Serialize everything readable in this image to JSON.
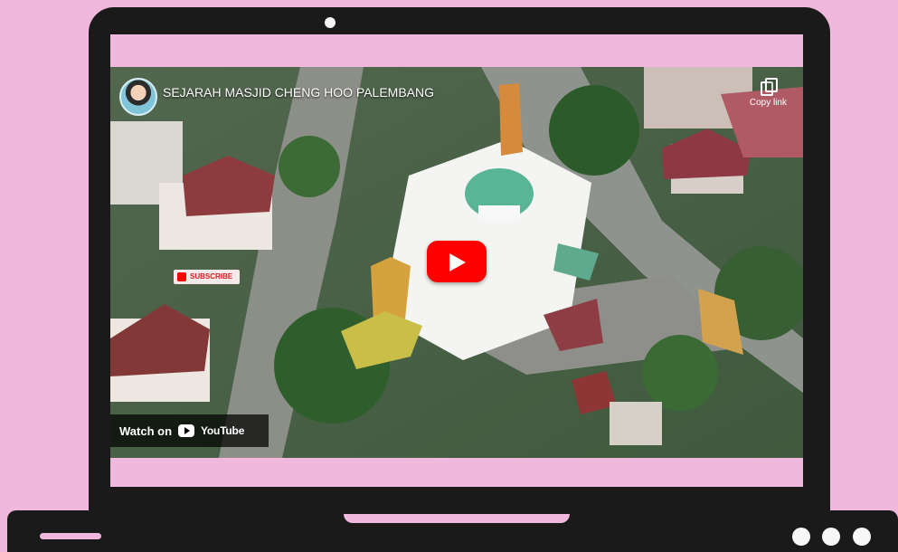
{
  "video": {
    "title": "SEJARAH MASJID CHENG HOO PALEMBANG",
    "copy_link_label": "Copy link",
    "subscribe_label": "SUBSCRIBE",
    "watch_on_label": "Watch on",
    "platform_label": "YouTube"
  },
  "icons": {
    "camera": "camera-dot",
    "avatar": "channel-avatar",
    "copy": "copy-icon",
    "play": "play-icon",
    "youtube": "youtube-logo"
  },
  "colors": {
    "background": "#efb8dc",
    "laptop": "#1a1a1a",
    "youtube_red": "#ff0000"
  }
}
